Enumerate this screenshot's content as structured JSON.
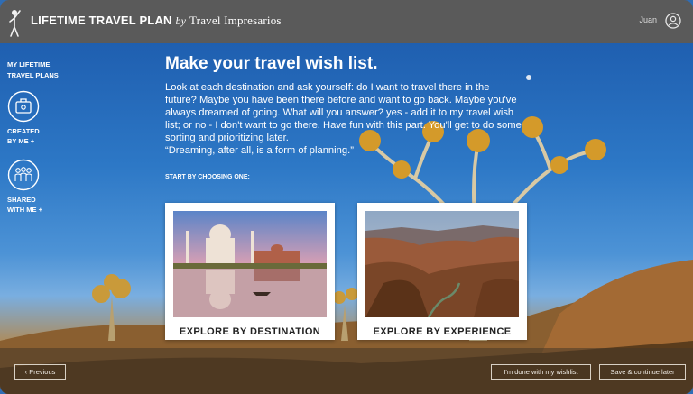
{
  "header": {
    "brand_name": "LIFETIME TRAVEL PLAN",
    "brand_by": "by",
    "brand_company": "Travel Impresarios",
    "user_name": "Juan",
    "logo_icon": "traveler-figure-icon",
    "user_icon": "user-circle-icon"
  },
  "sidebar": {
    "title_line1": "MY LIFETIME",
    "title_line2": "TRAVEL PLANS",
    "created_line1": "CREATED",
    "created_line2": "BY ME +",
    "created_icon": "suitcase-icon",
    "shared_line1": "SHARED",
    "shared_line2": "WITH ME +",
    "shared_icon": "people-group-icon"
  },
  "main": {
    "title": "Make your travel wish list.",
    "body": "Look at each destination and ask yourself: do I want to travel there in the future? Maybe you have been there before and want to go back. Maybe you've always dreamed of going. What will you answer? yes - add it to my travel wish list; or no - I don't want to go there. Have fun with this part. You'll get to do some sorting and prioritizing later.",
    "quote": "“Dreaming, after all, is a form of planning.”",
    "choose_label": "START BY CHOOSING ONE:",
    "cards": [
      {
        "label": "EXPLORE BY DESTINATION",
        "image": "taj-mahal-photo"
      },
      {
        "label": "EXPLORE BY EXPERIENCE",
        "image": "grand-canyon-photo"
      }
    ]
  },
  "footer": {
    "previous_label": "‹ Previous",
    "done_label": "I'm done with my wishlist",
    "save_label": "Save & continue later"
  },
  "colors": {
    "topbar": "#5a5a5a",
    "sky": "#2d78c6",
    "card_bg": "#ffffff"
  }
}
